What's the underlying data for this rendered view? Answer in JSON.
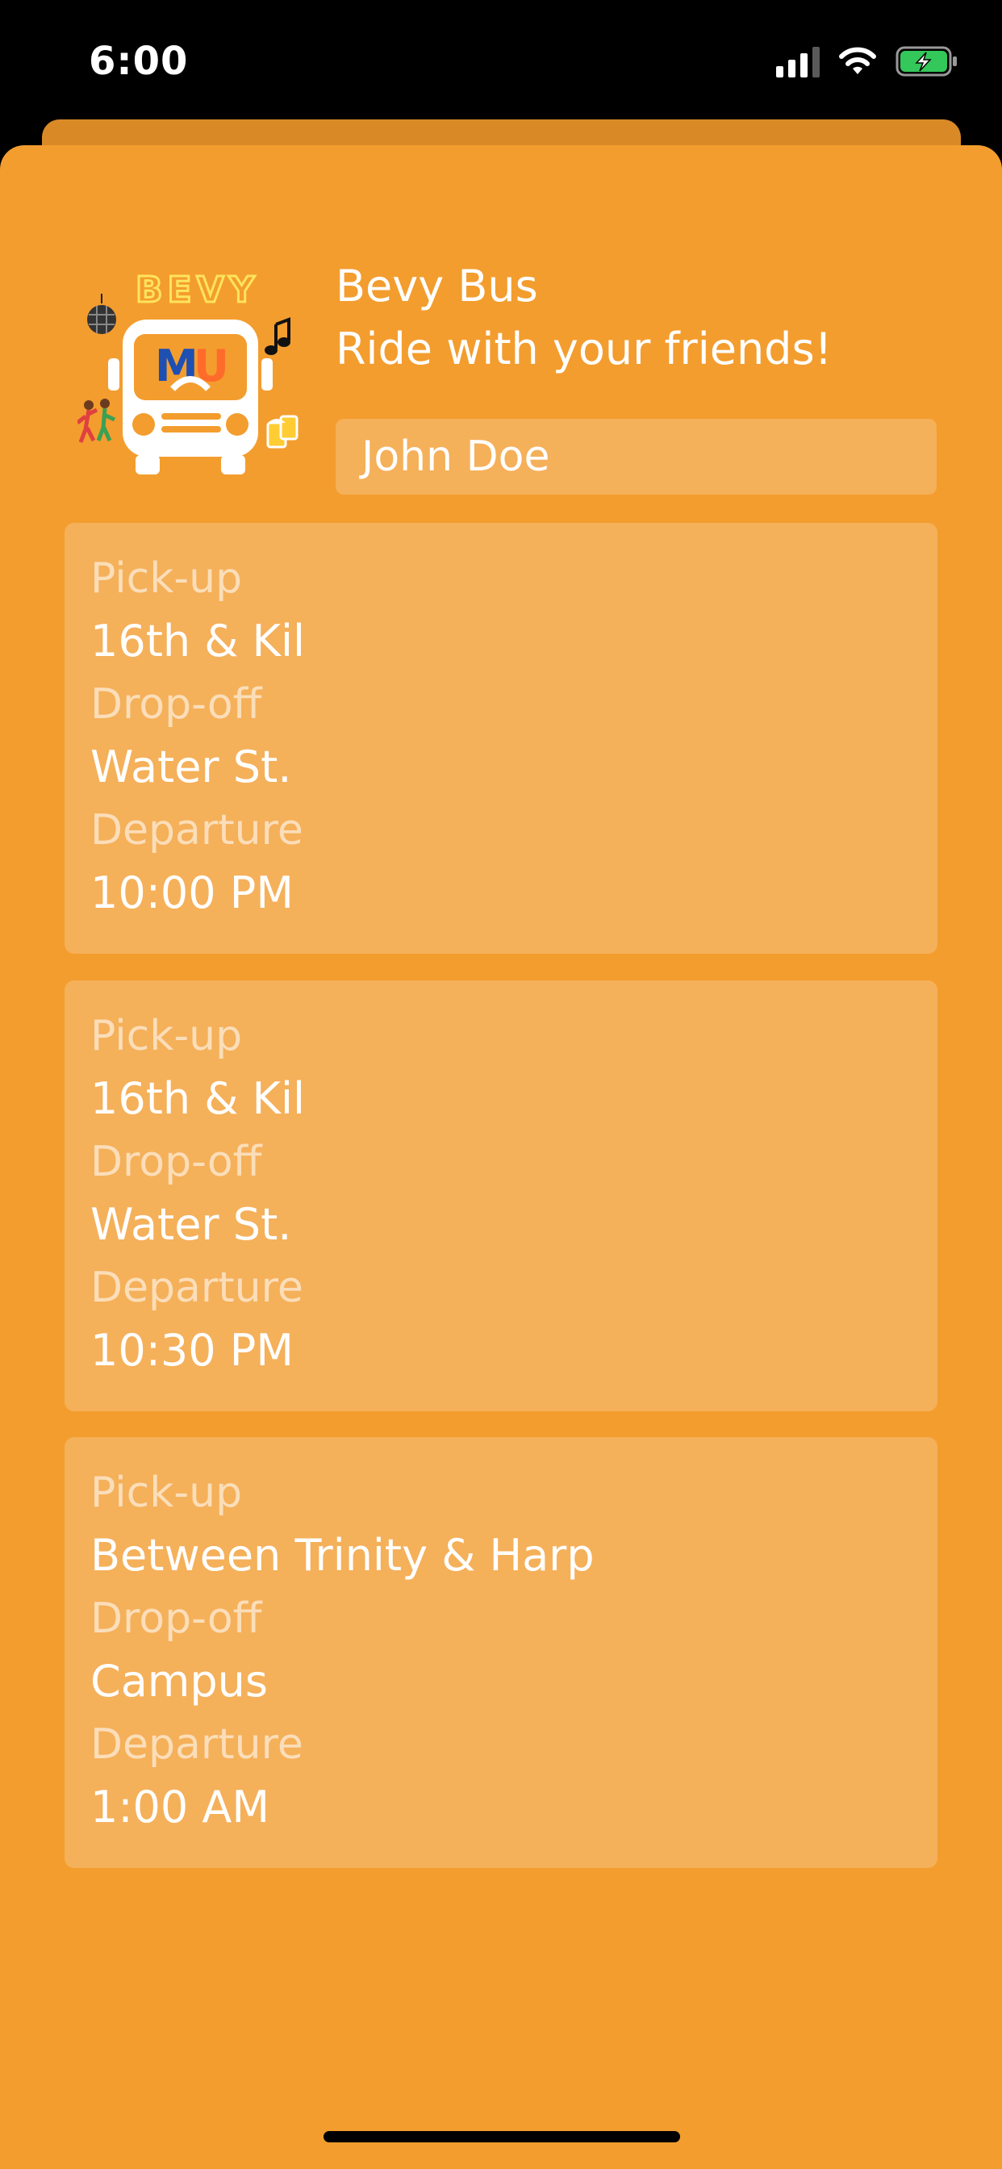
{
  "status_bar": {
    "time": "6:00",
    "icons": [
      "cellular-signal-icon",
      "wifi-icon",
      "battery-charging-icon"
    ]
  },
  "header": {
    "title": "Bevy Bus",
    "subtitle": "Ride with your friends!",
    "logo_text_top": "BEVY",
    "logo_text_mu": "MU"
  },
  "name_field": {
    "value": "John Doe"
  },
  "trips": [
    {
      "pickup_label": "Pick-up",
      "pickup": "16th & Kil",
      "dropoff_label": "Drop-off",
      "dropoff": "Water St.",
      "departure_label": "Departure",
      "departure": "10:00 PM"
    },
    {
      "pickup_label": "Pick-up",
      "pickup": "16th & Kil",
      "dropoff_label": "Drop-off",
      "dropoff": "Water St.",
      "departure_label": "Departure",
      "departure": "10:30 PM"
    },
    {
      "pickup_label": "Pick-up",
      "pickup": "Between Trinity & Harp",
      "dropoff_label": "Drop-off",
      "dropoff": "Campus",
      "departure_label": "Departure",
      "departure": "1:00 AM"
    }
  ],
  "colors": {
    "background": "#f39d2e",
    "card": "#f5b05a",
    "sheet_back": "#d98a27",
    "text": "#ffffff",
    "label_text": "rgba(255,255,255,0.58)",
    "battery_green": "#34c759",
    "logo_neon": "#ffe45c",
    "logo_blue": "#1e4fb3"
  }
}
